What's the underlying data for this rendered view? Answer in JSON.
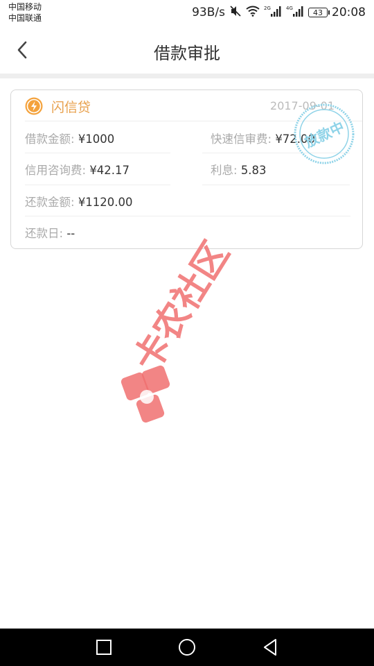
{
  "status_bar": {
    "carrier_1": "中国移动",
    "carrier_2": "中国联通",
    "net_speed": "93B/s",
    "battery": "43",
    "time": "20:08"
  },
  "header": {
    "title": "借款审批"
  },
  "loan_card": {
    "product_name": "闪信贷",
    "date": "2017-09-01",
    "fields": {
      "loan_amount": {
        "label": "借款金额:",
        "value": "¥1000"
      },
      "fast_fee": {
        "label": "快速信审费:",
        "value": "¥72.00"
      },
      "credit_fee": {
        "label": "信用咨询费:",
        "value": "¥42.17"
      },
      "interest": {
        "label": "利息:",
        "value": "5.83"
      },
      "repay_amount": {
        "label": "还款金额:",
        "value": "¥1120.00"
      },
      "repay_date": {
        "label": "还款日:",
        "value": "--"
      }
    },
    "stamp_text": "放款中",
    "colors": {
      "product": "#e8a04c",
      "stamp": "#8fd3e8"
    }
  },
  "watermark": {
    "text": "卡农社区",
    "color": "#f07070"
  },
  "nav_bar": {
    "icons": [
      "square-icon",
      "circle-icon",
      "triangle-back-icon"
    ]
  }
}
